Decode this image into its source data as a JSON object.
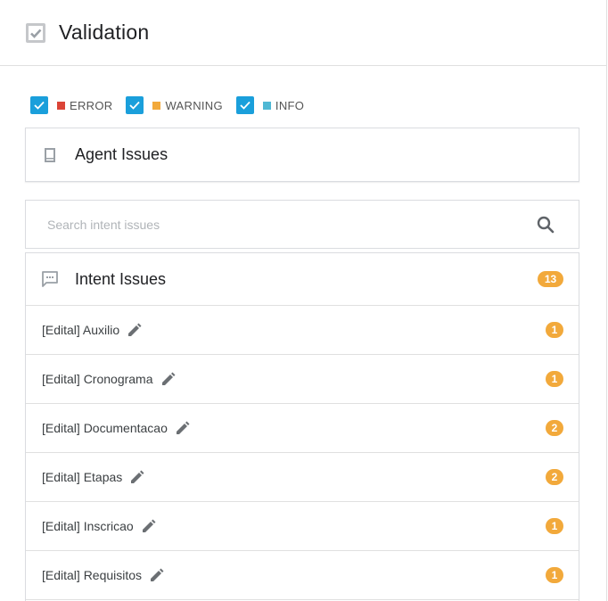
{
  "header": {
    "title": "Validation",
    "icon": "checkbox-icon"
  },
  "filters": [
    {
      "label": "ERROR",
      "color": "#db4437",
      "checked": true
    },
    {
      "label": "WARNING",
      "color": "#f2a93b",
      "checked": true
    },
    {
      "label": "INFO",
      "color": "#4fb8d4",
      "checked": true
    }
  ],
  "agent_issues": {
    "title": "Agent Issues",
    "icon": "book-icon"
  },
  "search": {
    "placeholder": "Search intent issues",
    "value": "",
    "icon": "search-icon"
  },
  "intent_issues": {
    "title": "Intent Issues",
    "icon": "chat-icon",
    "total": "13",
    "items": [
      {
        "name": "[Edital] Auxilio",
        "count": "1"
      },
      {
        "name": "[Edital] Cronograma",
        "count": "1"
      },
      {
        "name": "[Edital] Documentacao",
        "count": "2"
      },
      {
        "name": "[Edital] Etapas",
        "count": "2"
      },
      {
        "name": "[Edital] Inscricao",
        "count": "1"
      },
      {
        "name": "[Edital] Requisitos",
        "count": "1"
      }
    ]
  },
  "colors": {
    "accent": "#1a9fdb",
    "badge": "#f2a93b",
    "icon_gray": "#9aa0a6"
  }
}
